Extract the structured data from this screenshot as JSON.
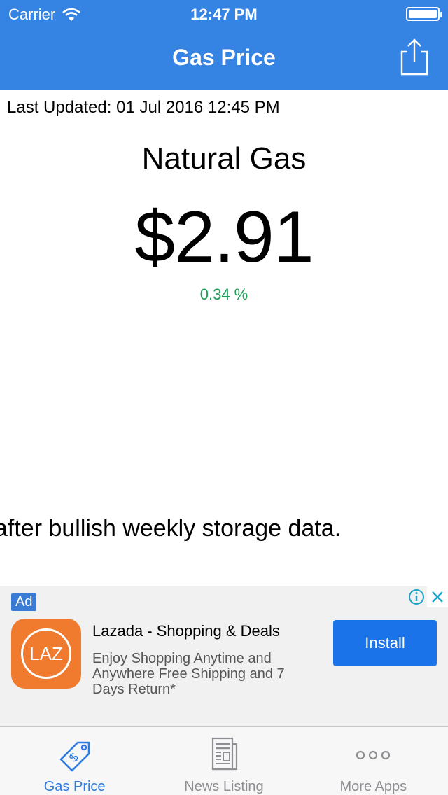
{
  "status_bar": {
    "carrier": "Carrier",
    "time": "12:47 PM"
  },
  "nav": {
    "title": "Gas Price",
    "share_icon": "share-icon"
  },
  "content": {
    "last_updated": "Last Updated: 01 Jul 2016 12:45 PM",
    "commodity": "Natural Gas",
    "price": "$2.91",
    "change": "0.34 %",
    "ticker_text": "after bullish weekly storage data."
  },
  "ad": {
    "badge": "Ad",
    "app_icon_text": "LAZ",
    "title": "Lazada - Shopping & Deals",
    "description": "Enjoy Shopping Anytime and Anywhere Free Shipping and 7 Days Return*",
    "install_label": "Install"
  },
  "tabbar": {
    "items": [
      {
        "label": "Gas Price",
        "icon": "price-tag-icon",
        "active": true
      },
      {
        "label": "News Listing",
        "icon": "newspaper-icon",
        "active": false
      },
      {
        "label": "More Apps",
        "icon": "more-dots-icon",
        "active": false
      }
    ]
  },
  "colors": {
    "nav_bg": "#3584E4",
    "change_positive": "#1E9E56",
    "install_button": "#1A73E8",
    "tab_active": "#2C7BDF",
    "tab_inactive": "#8E8E93"
  }
}
